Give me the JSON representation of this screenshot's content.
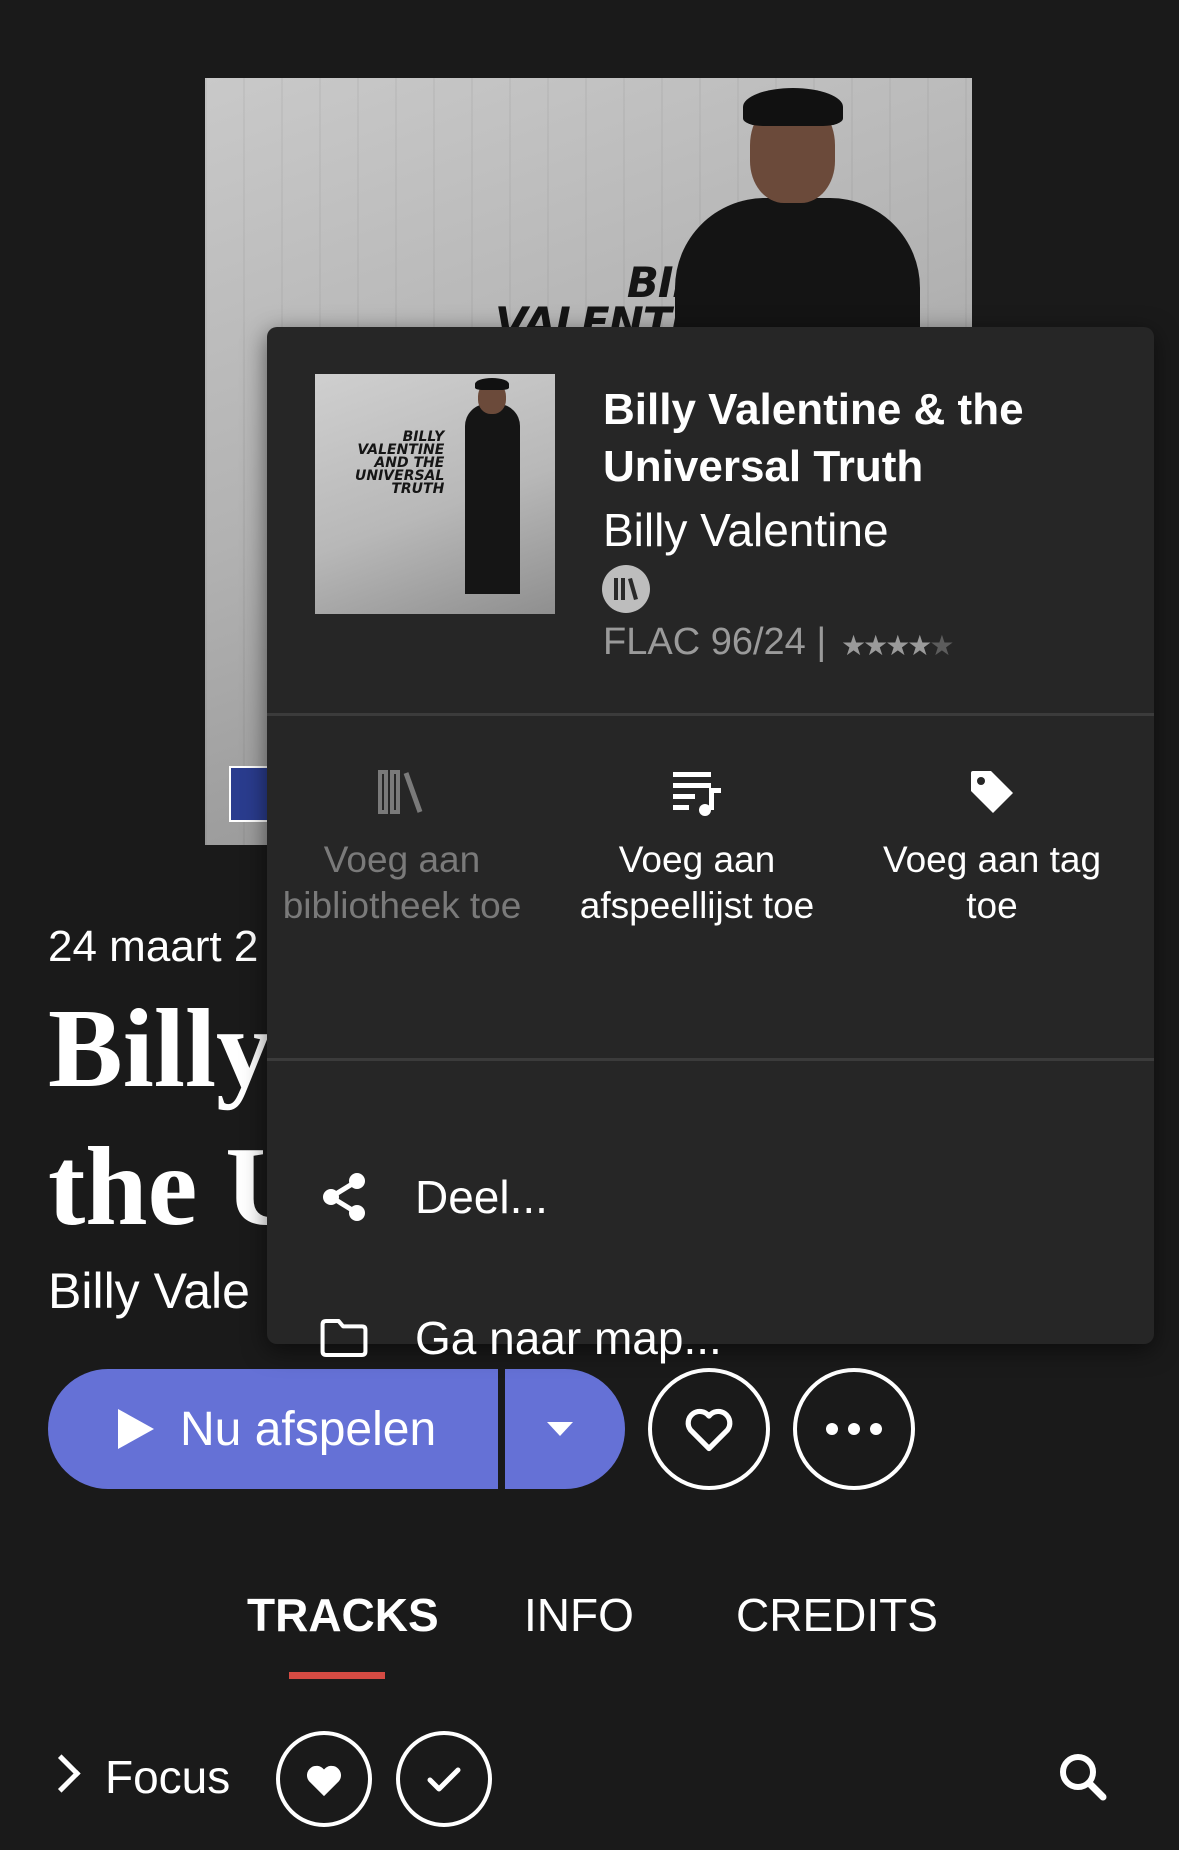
{
  "album": {
    "cover_text": [
      "BILLY",
      "VALENTINE"
    ],
    "date": "24 maart 2",
    "title_line1": "Billy",
    "title_line2": "the U",
    "artist": "Billy Vale"
  },
  "actions": {
    "play_label": "Nu afspelen"
  },
  "tabs": [
    {
      "label": "TRACKS",
      "active": true
    },
    {
      "label": "INFO",
      "active": false
    },
    {
      "label": "CREDITS",
      "active": false
    }
  ],
  "filter": {
    "label": "Focus"
  },
  "menu": {
    "title": "Billy Valentine & the Universal Truth",
    "artist": "Billy Valentine",
    "format": "FLAC 96/24 |",
    "rating": 4,
    "rating_max": 5,
    "thumb_text": [
      "BILLY",
      "VALENTINE",
      "AND THE",
      "UNIVERSAL",
      "TRUTH"
    ],
    "add_library": "Voeg aan bibliotheek toe",
    "add_playlist": "Voeg aan afspeellijst toe",
    "add_tag": "Voeg aan tag toe",
    "share": "Deel...",
    "goto_folder": "Ga naar map..."
  },
  "colors": {
    "background": "#1a1a1a",
    "menu_bg": "#262626",
    "accent": "#6571d6",
    "tab_underline": "#d54b43",
    "disabled_text": "#7a7a7a"
  }
}
